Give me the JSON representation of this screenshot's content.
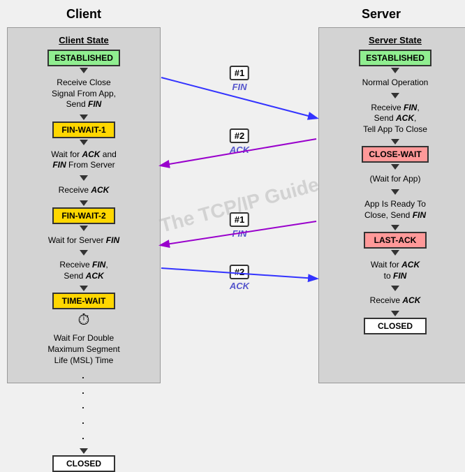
{
  "title": {
    "client": "Client",
    "server": "Server"
  },
  "client": {
    "state_label": "Client State",
    "states": {
      "established": "ESTABLISHED",
      "fin_wait_1": "FIN-WAIT-1",
      "fin_wait_2": "FIN-WAIT-2",
      "time_wait": "TIME-WAIT",
      "closed": "CLOSED"
    },
    "descriptions": {
      "d1": "Receive Close Signal From App, Send FIN",
      "d2": "Wait for ACK and FIN From Server",
      "d3": "Receive ACK",
      "d4": "Wait for Server FIN",
      "d5": "Receive FIN, Send ACK",
      "d6": "Wait For Double Maximum Segment Life (MSL) Time"
    }
  },
  "server": {
    "state_label": "Server State",
    "states": {
      "established": "ESTABLISHED",
      "close_wait": "CLOSE-WAIT",
      "last_ack": "LAST-ACK",
      "closed": "CLOSED"
    },
    "descriptions": {
      "d1": "Normal Operation",
      "d2": "Receive FIN, Send ACK, Tell App To Close",
      "d3": "(Wait for App)",
      "d4": "App Is Ready To Close, Send FIN",
      "d5": "Wait for ACK to FIN",
      "d6": "Receive ACK"
    }
  },
  "messages": {
    "fin1_num": "#1",
    "fin1_label": "FIN",
    "ack1_num": "#2",
    "ack1_label": "ACK",
    "fin2_num": "#1",
    "fin2_label": "FIN",
    "ack2_num": "#2",
    "ack2_label": "ACK"
  },
  "watermark": "The TCP/IP Guide"
}
